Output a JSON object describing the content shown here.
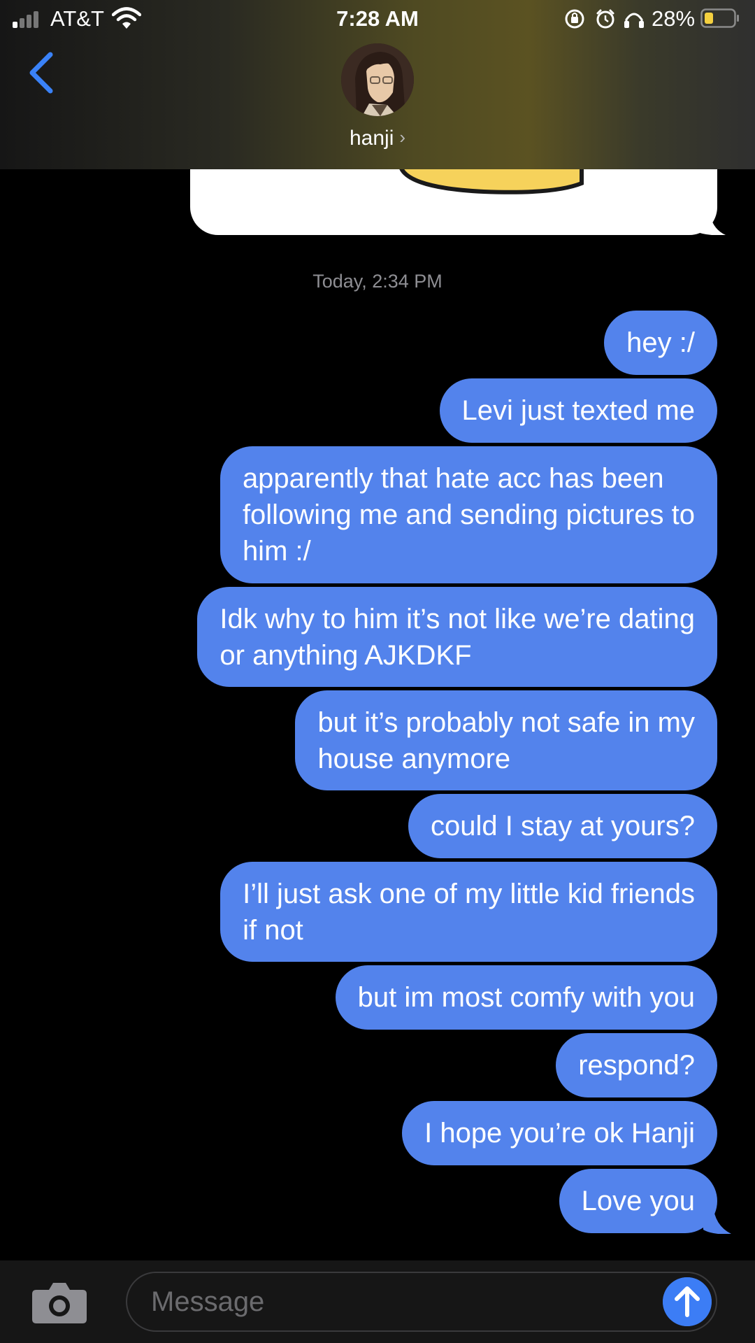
{
  "status_bar": {
    "carrier": "AT&T",
    "time": "7:28 AM",
    "battery_percent": "28%",
    "icons": [
      "signal-icon",
      "wifi-icon",
      "orientation-lock-icon",
      "alarm-icon",
      "headphones-icon",
      "battery-icon"
    ]
  },
  "header": {
    "contact_name": "hanji",
    "back_icon": "chevron-left-icon",
    "chevron": "›"
  },
  "conversation": {
    "timestamp": "Today, 2:34 PM",
    "messages": [
      "hey :/",
      "Levi just texted me",
      "apparently that hate acc has been\nfollowing me and sending pictures to\nhim :/",
      "Idk why to him it’s not like we’re dating\nor anything AJKDKF",
      "but it’s probably not safe in my\nhouse anymore",
      "could I stay at yours?",
      "I’ll just ask one of my little kid friends\nif not",
      "but im most comfy with you",
      "respond?",
      "I hope you’re ok Hanji",
      "Love you"
    ]
  },
  "input_bar": {
    "placeholder": "Message",
    "camera_icon": "camera-icon",
    "send_icon": "arrow-up-icon"
  },
  "colors": {
    "sent_bubble": "#5383ec",
    "send_button": "#3c7df5",
    "back_chevron": "#3a82f7",
    "battery_fill": "#f4d03f"
  }
}
